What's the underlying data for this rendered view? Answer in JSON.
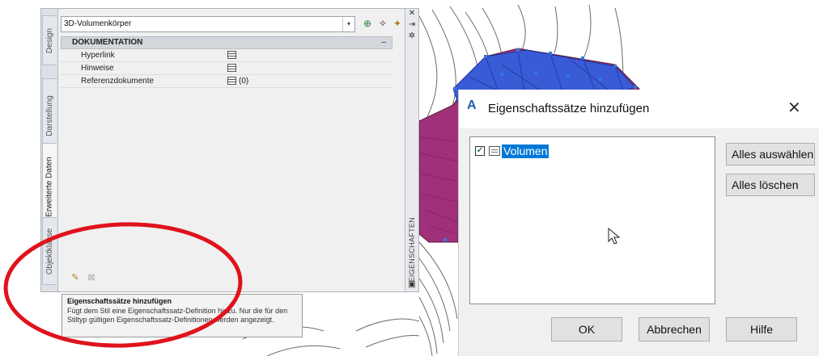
{
  "palette": {
    "style_value": "3D-Volumenkörper",
    "side_tabs": [
      "Design",
      "Darstellung",
      "Erweiterte Daten",
      "Objektklasse"
    ],
    "section": "DOKUMENTATION",
    "collapse_symbol": "–",
    "rows": [
      {
        "name": "Hyperlink",
        "value": ""
      },
      {
        "name": "Hinweise",
        "value": ""
      },
      {
        "name": "Referenzdokumente",
        "value": "(0)"
      }
    ],
    "strip_title": "EIGENSCHAFTEN"
  },
  "tooltip": {
    "title": "Eigenschaftssätze hinzufügen",
    "body": "Fügt dem Stil eine Eigenschaftssatz-Definition hinzu. Nur die für den Stiltyp gültigen Eigenschaftssatz-Definitionen werden angezeigt."
  },
  "dialog": {
    "title": "Eigenschaftssätze hinzufügen",
    "close_symbol": "✕",
    "list_items": [
      {
        "label": "Volumen",
        "checked": true
      }
    ],
    "select_all": "Alles auswählen",
    "clear_all": "Alles löschen",
    "ok": "OK",
    "cancel": "Abbrechen",
    "help": "Hilfe"
  },
  "colors": {
    "accent_selection": "#0078d7",
    "annotation_red": "#e0121b",
    "solid_purple": "#a0307a",
    "solid_blue": "#3a5bd6"
  }
}
